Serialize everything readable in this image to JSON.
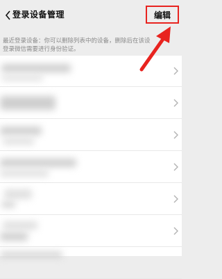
{
  "nav": {
    "title": "登录设备管理",
    "edit_label": "编辑"
  },
  "description": {
    "line1": "最近登录设备：你可以删除列表中的设备，删除后在该设",
    "line2": "登录微信需要进行身份验证。"
  },
  "devices": [
    {
      "name": ""
    },
    {
      "name": ""
    },
    {
      "name": ""
    },
    {
      "name": ""
    },
    {
      "name": ""
    },
    {
      "name": ""
    },
    {
      "name": ""
    }
  ],
  "colors": {
    "annotation": "#e8231f",
    "background": "#ededed"
  }
}
